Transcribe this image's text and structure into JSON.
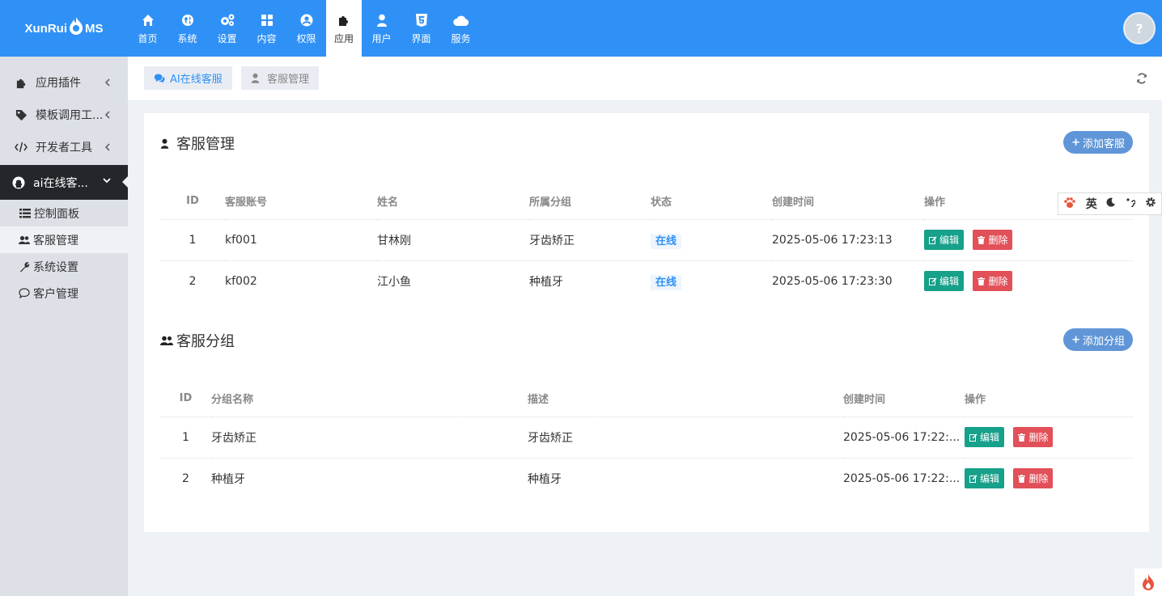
{
  "brand": {
    "logo_left": "XunRui",
    "logo_right": "MS"
  },
  "nav": [
    {
      "label": "首页",
      "icon": "home-icon"
    },
    {
      "label": "系统",
      "icon": "globe-icon"
    },
    {
      "label": "设置",
      "icon": "cogs-icon"
    },
    {
      "label": "内容",
      "icon": "grid-icon"
    },
    {
      "label": "权限",
      "icon": "user-circle-icon"
    },
    {
      "label": "应用",
      "icon": "puzzle-icon"
    },
    {
      "label": "用户",
      "icon": "user-icon"
    },
    {
      "label": "界面",
      "icon": "html5-icon"
    },
    {
      "label": "服务",
      "icon": "cloud-icon"
    }
  ],
  "sidebar": {
    "items": [
      {
        "label": "应用插件",
        "icon": "puzzle-icon"
      },
      {
        "label": "模板调用工...",
        "icon": "tag-icon"
      },
      {
        "label": "开发者工具",
        "icon": "code-icon"
      },
      {
        "label": "ai在线客...",
        "icon": "github-icon"
      }
    ],
    "sub": [
      {
        "label": "控制面板",
        "icon": "list-icon"
      },
      {
        "label": "客服管理",
        "icon": "users-icon"
      },
      {
        "label": "系统设置",
        "icon": "wrench-icon"
      },
      {
        "label": "客户管理",
        "icon": "comment-icon"
      }
    ]
  },
  "tabs": [
    {
      "label": "AI在线客服",
      "icon": "comments-icon"
    },
    {
      "label": "客服管理",
      "icon": "user-icon"
    }
  ],
  "agents": {
    "title": "客服管理",
    "add_label": "添加客服",
    "columns": [
      "ID",
      "客服账号",
      "姓名",
      "所属分组",
      "状态",
      "创建时间",
      "操作"
    ],
    "rows": [
      {
        "id": "1",
        "account": "kf001",
        "name": "甘林刚",
        "group": "牙齿矫正",
        "status": "在线",
        "created": "2025-05-06 17:23:13"
      },
      {
        "id": "2",
        "account": "kf002",
        "name": "江小鱼",
        "group": "种植牙",
        "status": "在线",
        "created": "2025-05-06 17:23:30"
      }
    ]
  },
  "groups": {
    "title": "客服分组",
    "add_label": "添加分组",
    "columns": [
      "ID",
      "分组名称",
      "描述",
      "创建时间",
      "操作"
    ],
    "rows": [
      {
        "id": "1",
        "name": "牙齿矫正",
        "desc": "牙齿矫正",
        "created": "2025-05-06 17:22:..."
      },
      {
        "id": "2",
        "name": "种植牙",
        "desc": "种植牙",
        "created": "2025-05-06 17:22:..."
      }
    ]
  },
  "actions": {
    "edit": "编辑",
    "delete": "删除"
  },
  "ime": {
    "lang": "英"
  },
  "colors": {
    "primary": "#2f91f6",
    "edit": "#17a08a",
    "delete": "#e2505a",
    "add": "#6096d8",
    "sidebar_active": "#23272b"
  }
}
